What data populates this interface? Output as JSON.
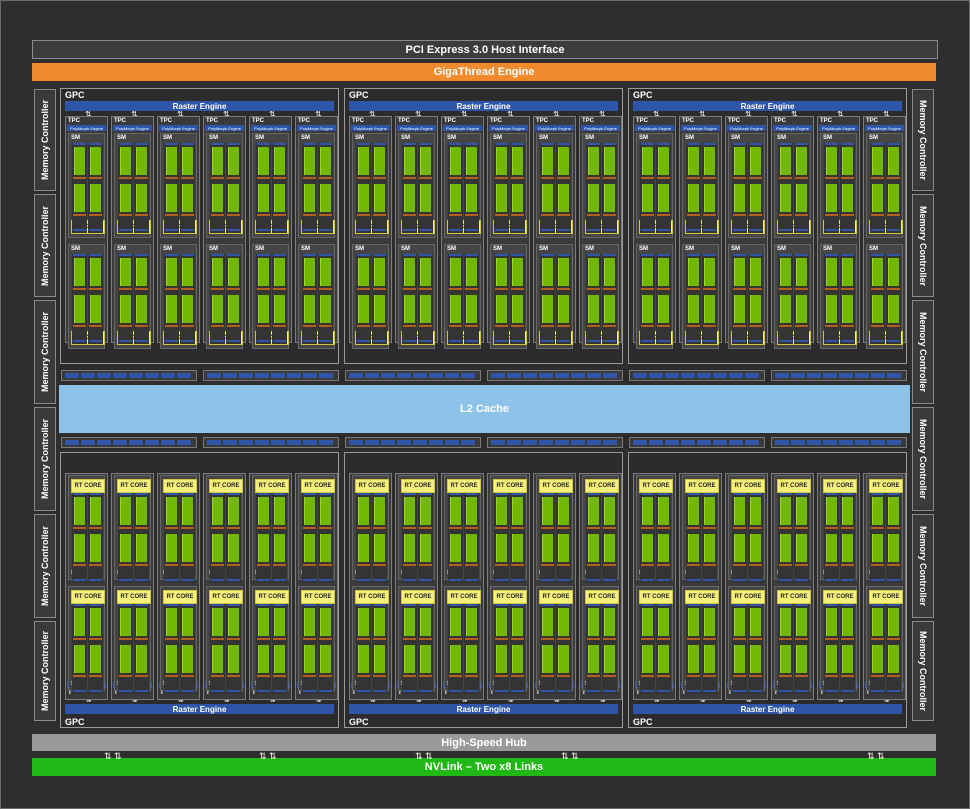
{
  "diagram": {
    "host_interface": "PCI Express 3.0 Host Interface",
    "giga_thread": "GigaThread Engine",
    "l2_cache": "L2 Cache",
    "high_speed_hub": "High-Speed Hub",
    "nvlink": "NVLink – Two x8 Links",
    "memory_controller": "Memory Controller",
    "gpc_label": "GPC",
    "raster_engine": "Raster Engine",
    "tpc_label": "TPC",
    "polymorph_engine": "PolyMorph Engine",
    "sm_label": "SM",
    "rt_core": "RT CORE"
  },
  "structure": {
    "gpc_count": 6,
    "tpcs_per_gpc": 6,
    "sms_per_tpc": 2,
    "memory_controllers_per_side": 6
  },
  "colors": {
    "chip_background": "#2e2e2e",
    "giga_thread": "#f08a2c",
    "nvlink": "#21b815",
    "high_speed_hub": "#9a9a9a",
    "l2_cache": "#8ec3e9",
    "raster_engine": "#2f55a8",
    "cuda_cores": "#73b800",
    "rt_core": "#f5f07a"
  }
}
